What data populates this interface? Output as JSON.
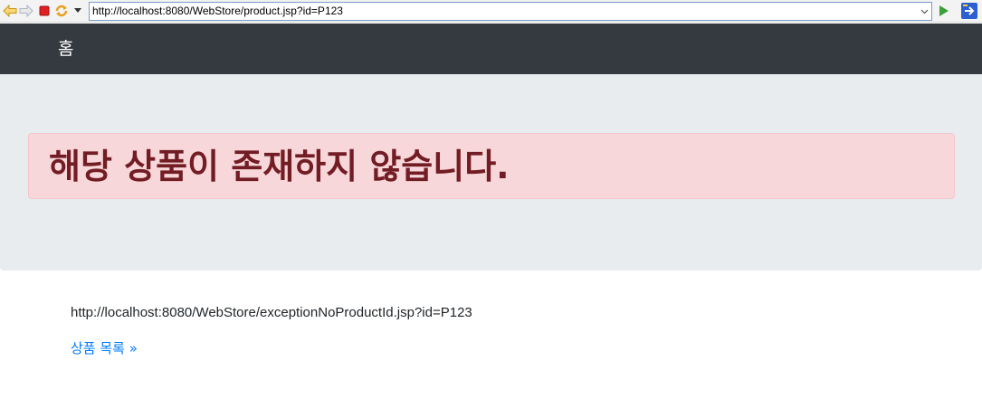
{
  "browser": {
    "url": "http://localhost:8080/WebStore/product.jsp?id=P123",
    "icons": [
      "back-arrow-icon",
      "forward-arrow-icon",
      "stop-icon",
      "refresh-icon",
      "menu-dropdown-icon",
      "url-dropdown-icon",
      "go-icon",
      "browser-extension-icon"
    ]
  },
  "navbar": {
    "brand": "홈"
  },
  "alert": {
    "message": "해당 상품이 존재하지 않습니다."
  },
  "content": {
    "request_url": "http://localhost:8080/WebStore/exceptionNoProductId.jsp?id=P123",
    "products_link": "상품 목록 »"
  },
  "colors": {
    "navbar_bg": "#343a40",
    "jumbotron_bg": "#e9ecef",
    "alert_bg": "#f8d7da",
    "alert_text": "#721c24",
    "link": "#007bff"
  }
}
